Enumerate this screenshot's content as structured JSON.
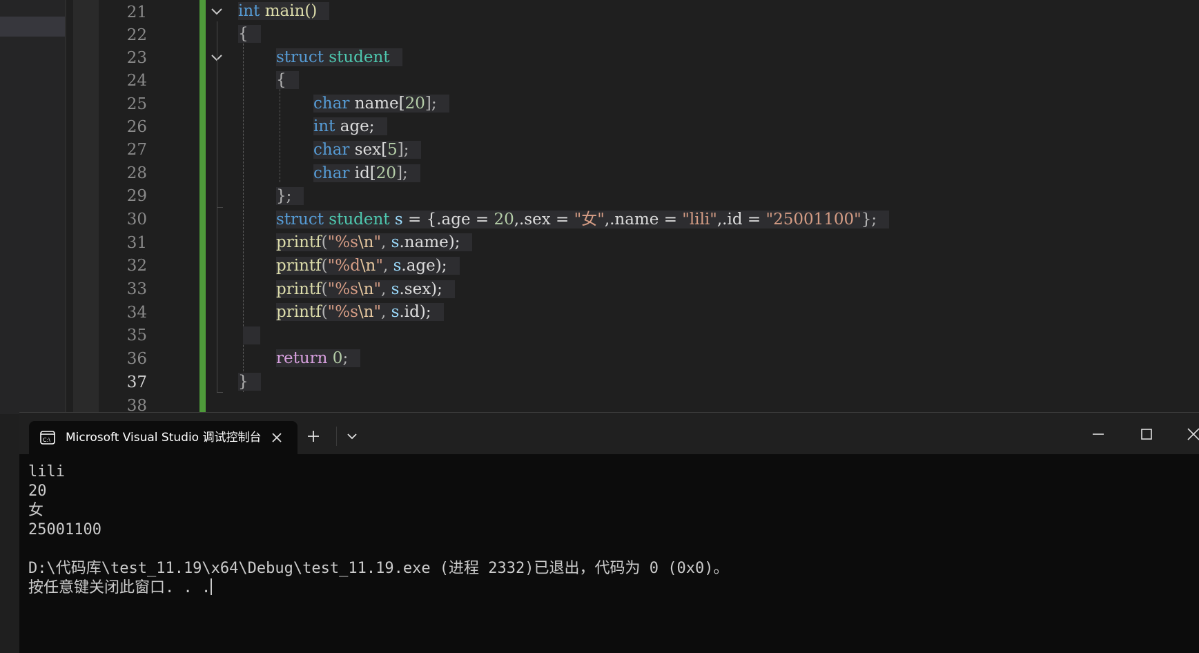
{
  "editor": {
    "line_numbers": [
      "21",
      "22",
      "23",
      "24",
      "25",
      "26",
      "27",
      "28",
      "29",
      "30",
      "31",
      "32",
      "33",
      "34",
      "35",
      "36",
      "37",
      "38"
    ],
    "active_line": "37",
    "code": {
      "l21_kw": "int",
      "l21_rest": " main()",
      "l22": "{",
      "l23_kw": "struct",
      "l23_ty": "student",
      "l24": "{",
      "l25_kw": "char",
      "l25_name": " name[",
      "l25_num": "20",
      "l25_end": "];",
      "l26_kw": "int",
      "l26_rest": " age;",
      "l27_kw": "char",
      "l27_name": " sex[",
      "l27_num": "5",
      "l27_end": "];",
      "l28_kw": "char",
      "l28_name": " id[",
      "l28_num": "20",
      "l28_end": "];",
      "l29": "};",
      "l30_kw": "struct",
      "l30_ty": "student",
      "l30_var": "s",
      "l30_p1": " = {.age = ",
      "l30_num": "20",
      "l30_p2": ",.sex = ",
      "l30_s1": "\"女\"",
      "l30_p3": ",.name = ",
      "l30_s2": "\"lili\"",
      "l30_p4": ",.id = ",
      "l30_s3": "\"25001100\"",
      "l30_p5": "};",
      "l31_fn": "printf",
      "l31_p": "(",
      "l31_s": "\"%s",
      "l31_e": "\\n",
      "l31_q": "\"",
      "l31_c": ", ",
      "l31_v": "s",
      "l31_m": ".name);",
      "l32_fn": "printf",
      "l32_p": "(",
      "l32_s": "\"%d",
      "l32_e": "\\n",
      "l32_q": "\"",
      "l32_c": ", ",
      "l32_v": "s",
      "l32_m": ".age);",
      "l33_fn": "printf",
      "l33_p": "(",
      "l33_s": "\"%s",
      "l33_e": "\\n",
      "l33_q": "\"",
      "l33_c": ", ",
      "l33_v": "s",
      "l33_m": ".sex);",
      "l34_fn": "printf",
      "l34_p": "(",
      "l34_s": "\"%s",
      "l34_e": "\\n",
      "l34_q": "\"",
      "l34_c": ", ",
      "l34_v": "s",
      "l34_m": ".id);",
      "l36_kw": "return",
      "l36_num": "0",
      "l36_end": ";",
      "l37": "}"
    }
  },
  "terminal": {
    "tab_title": "Microsoft Visual Studio 调试控制台",
    "output_lines": [
      "lili",
      "20",
      "女",
      "25001100",
      "",
      "D:\\代码库\\test_11.19\\x64\\Debug\\test_11.19.exe (进程 2332)已退出，代码为 0 (0x0)。",
      "按任意键关闭此窗口. . ."
    ]
  },
  "colors": {
    "keyword": "#569cd6",
    "type": "#4ec9b0",
    "function": "#dcdcaa",
    "number": "#b5cea8",
    "string": "#d69d85",
    "change_bar": "#4e9a3a"
  },
  "icons": {
    "fold": "chevron-down-icon",
    "tab": "console-icon",
    "tab_close": "close-icon",
    "new_tab": "plus-icon",
    "dropdown": "chevron-down-icon",
    "minimize": "minimize-icon",
    "maximize": "maximize-icon",
    "close": "close-icon"
  }
}
